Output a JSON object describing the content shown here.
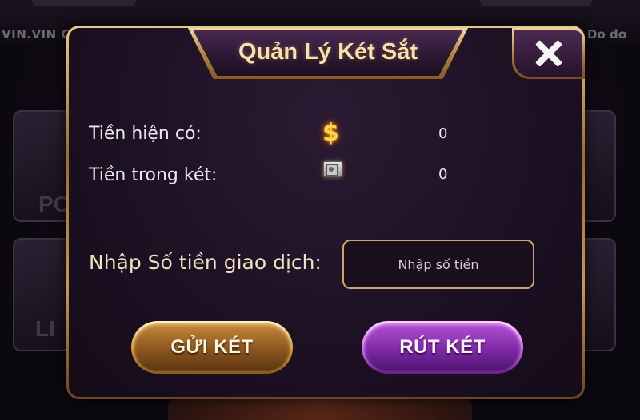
{
  "background": {
    "marquee_left": "VIN.VIN C",
    "marquee_right": "Do đơ",
    "card_texts": [
      "PO",
      "LI"
    ]
  },
  "dialog": {
    "title": "Quản Lý Két Sắt",
    "close_icon": "close-icon",
    "balance_label": "Tiền hiện có:",
    "balance_icon": "dollar-icon",
    "balance_value": "0",
    "safe_label": "Tiền trong két:",
    "safe_icon": "safe-icon",
    "safe_value": "0",
    "amount_label": "Nhập Số tiền giao dịch:",
    "amount_placeholder": "Nhập số tiền",
    "amount_value": "",
    "deposit_button": "GỬI KÉT",
    "withdraw_button": "RÚT KÉT"
  },
  "colors": {
    "gold_accent": "#c9974f",
    "purple_button": "#7e2aa6",
    "title_text": "#f7e1b3"
  }
}
